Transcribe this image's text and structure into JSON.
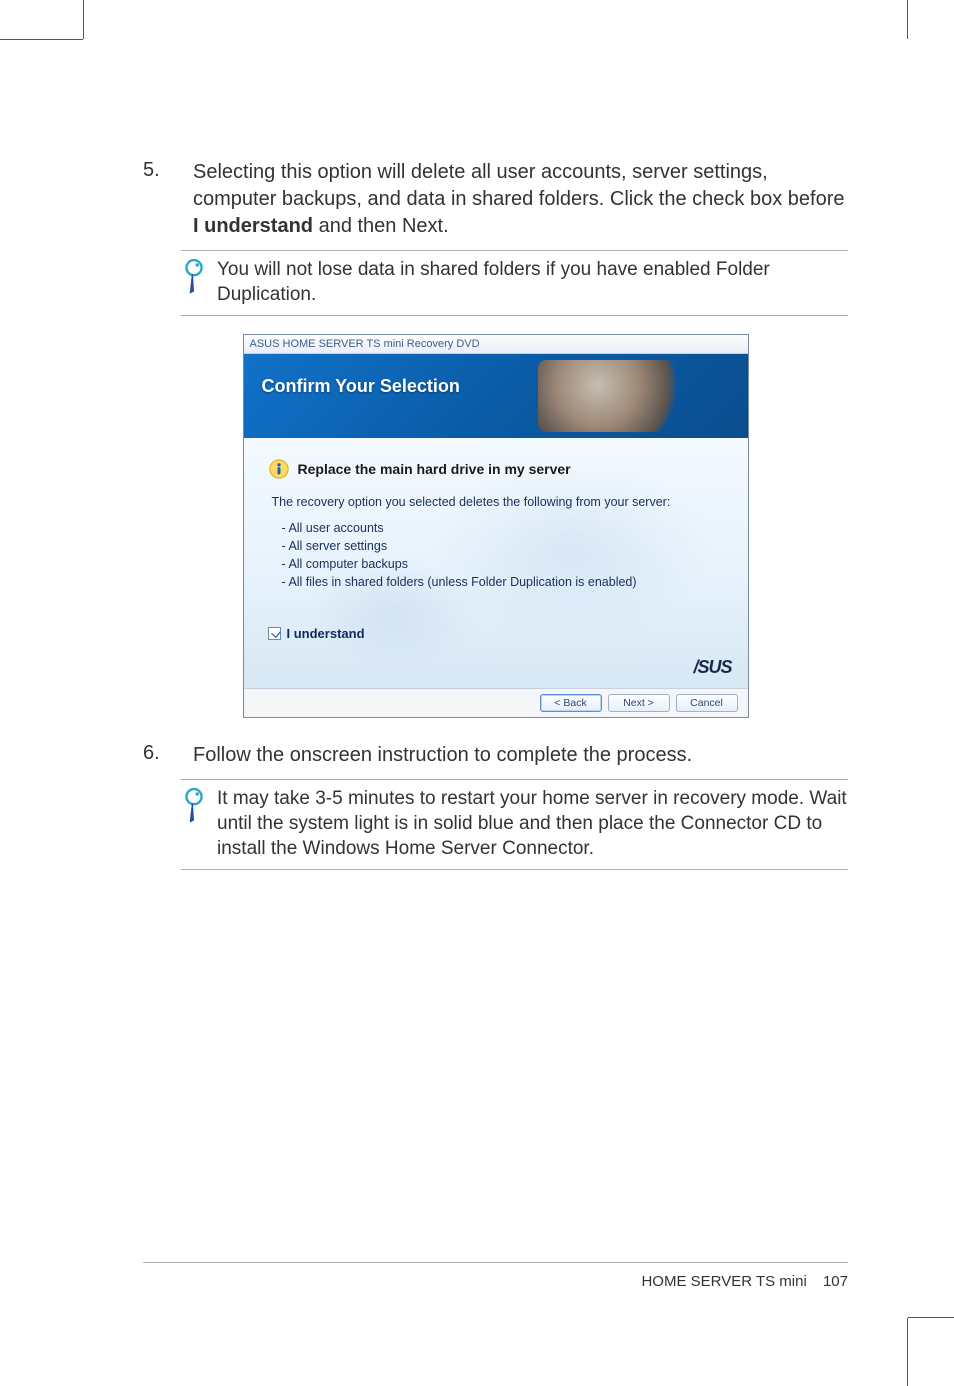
{
  "step5": {
    "num": "5.",
    "text_before": "Selecting this option will delete all user accounts, server settings, computer backups, and data in shared folders. Click the check box before ",
    "bold": "I understand",
    "text_after": " and then Next."
  },
  "note1": "You will not lose data in shared folders if you have enabled Folder Duplication.",
  "dialog": {
    "title": "ASUS HOME SERVER TS mini Recovery DVD",
    "banner": "Confirm Your Selection",
    "heading": "Replace the main hard drive in my server",
    "desc": "The recovery option you selected deletes the following from your server:",
    "items": [
      "- All user accounts",
      "- All server settings",
      "- All computer backups",
      "- All files in shared folders (unless Folder Duplication is enabled)"
    ],
    "check_label": "I understand",
    "brand": "/SUS",
    "back": "< Back",
    "next": "Next >",
    "cancel": "Cancel"
  },
  "step6": {
    "num": "6.",
    "text": "Follow the onscreen instruction to complete the process."
  },
  "note2": "It may take 3-5 minutes to restart your home server in recovery mode. Wait until the system light is in solid blue and then place the Connector CD to install the Windows Home Server Connector.",
  "footer": {
    "product": "HOME SERVER TS mini",
    "page": "107"
  }
}
